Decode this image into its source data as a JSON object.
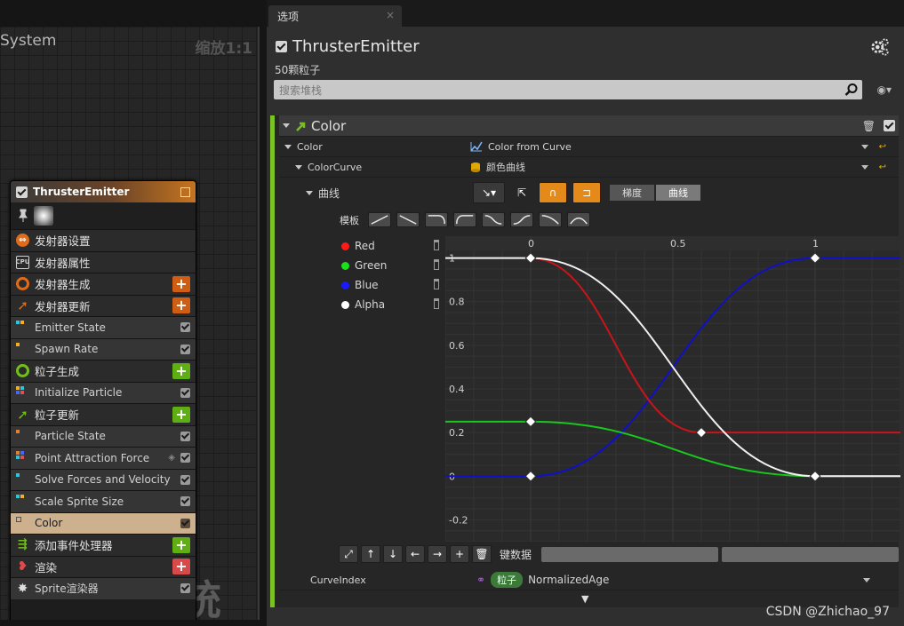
{
  "graph": {
    "title": "System",
    "zoom": "缩放1:1",
    "watermark": "系统",
    "node": {
      "name": "ThrusterEmitter",
      "rows": [
        {
          "label": "发射器设置",
          "kind": "sec",
          "icon": "emitter-settings-icon",
          "color": "#e06b1a"
        },
        {
          "label": "发射器属性",
          "kind": "sec",
          "icon": "cpu-icon",
          "color": "#cfcfcf"
        },
        {
          "label": "发射器生成",
          "kind": "sec",
          "icon": "spawn-ring-icon",
          "color": "#e06b1a",
          "plus": "#d05e12"
        },
        {
          "label": "发射器更新",
          "kind": "sec",
          "icon": "update-arrow-icon",
          "color": "#e06b1a",
          "plus": "#d05e12"
        },
        {
          "label": "Emitter State",
          "kind": "sub"
        },
        {
          "label": "Spawn Rate",
          "kind": "sub"
        },
        {
          "label": "粒子生成",
          "kind": "sec",
          "icon": "spawn-ring-icon",
          "color": "#72bf1a",
          "plus": "#5fae14"
        },
        {
          "label": "Initialize Particle",
          "kind": "sub"
        },
        {
          "label": "粒子更新",
          "kind": "sec",
          "icon": "update-arrow-icon",
          "color": "#72bf1a",
          "plus": "#5fae14"
        },
        {
          "label": "Particle State",
          "kind": "sub"
        },
        {
          "label": "Point Attraction Force",
          "kind": "sub"
        },
        {
          "label": "Solve Forces and Velocity",
          "kind": "sub"
        },
        {
          "label": "Scale Sprite Size",
          "kind": "sub"
        },
        {
          "label": "Color",
          "kind": "sub",
          "selected": true
        },
        {
          "label": "添加事件处理器",
          "kind": "sec",
          "icon": "event-handler-icon",
          "color": "#72bf1a",
          "plus": "#5fae14"
        },
        {
          "label": "渲染",
          "kind": "sec",
          "icon": "render-icon",
          "color": "#e04a4a",
          "plus": "#d84a4a"
        },
        {
          "label": "Sprite渲染器",
          "kind": "sub",
          "icon": "sprite-icon"
        }
      ]
    }
  },
  "tab": {
    "label": "选项",
    "close": "×"
  },
  "details": {
    "title": "ThrusterEmitter",
    "count": "50颗粒子",
    "search_placeholder": "搜索堆栈",
    "color_section": "Color",
    "rows": {
      "color_label": "Color",
      "color_value": "Color from Curve",
      "colorcurve_label": "ColorCurve",
      "colorcurve_value": "颜色曲线",
      "curve_label": "曲线",
      "seg_gradient": "梯度",
      "seg_curve": "曲线",
      "template_label": "模板",
      "key_data_label": "键数据",
      "curveindex_label": "CurveIndex",
      "curveindex_tag": "粒子",
      "curveindex_value": "NormalizedAge"
    }
  },
  "watermark_text": "CSDN @Zhichao_97",
  "chart_data": {
    "type": "line",
    "x_range": [
      -0.3,
      1.3
    ],
    "ylim": [
      -0.3,
      1.1
    ],
    "x_ticks": [
      0,
      0.5,
      1
    ],
    "y_ticks": [
      "1",
      "0.8",
      "0.6",
      "0.4",
      "0.2",
      "0",
      "-0.2"
    ],
    "series": [
      {
        "name": "Red",
        "color": "#c8151a",
        "keys": [
          [
            0,
            1
          ],
          [
            0.6,
            0.2
          ]
        ]
      },
      {
        "name": "Green",
        "color": "#18c81d",
        "keys": [
          [
            0,
            0.25
          ],
          [
            1,
            0
          ]
        ]
      },
      {
        "name": "Blue",
        "color": "#1010c8",
        "keys": [
          [
            0,
            0
          ],
          [
            1,
            1
          ]
        ]
      },
      {
        "name": "Alpha",
        "color": "#f0f0f0",
        "keys": [
          [
            0,
            1
          ],
          [
            1,
            0
          ]
        ]
      }
    ]
  }
}
